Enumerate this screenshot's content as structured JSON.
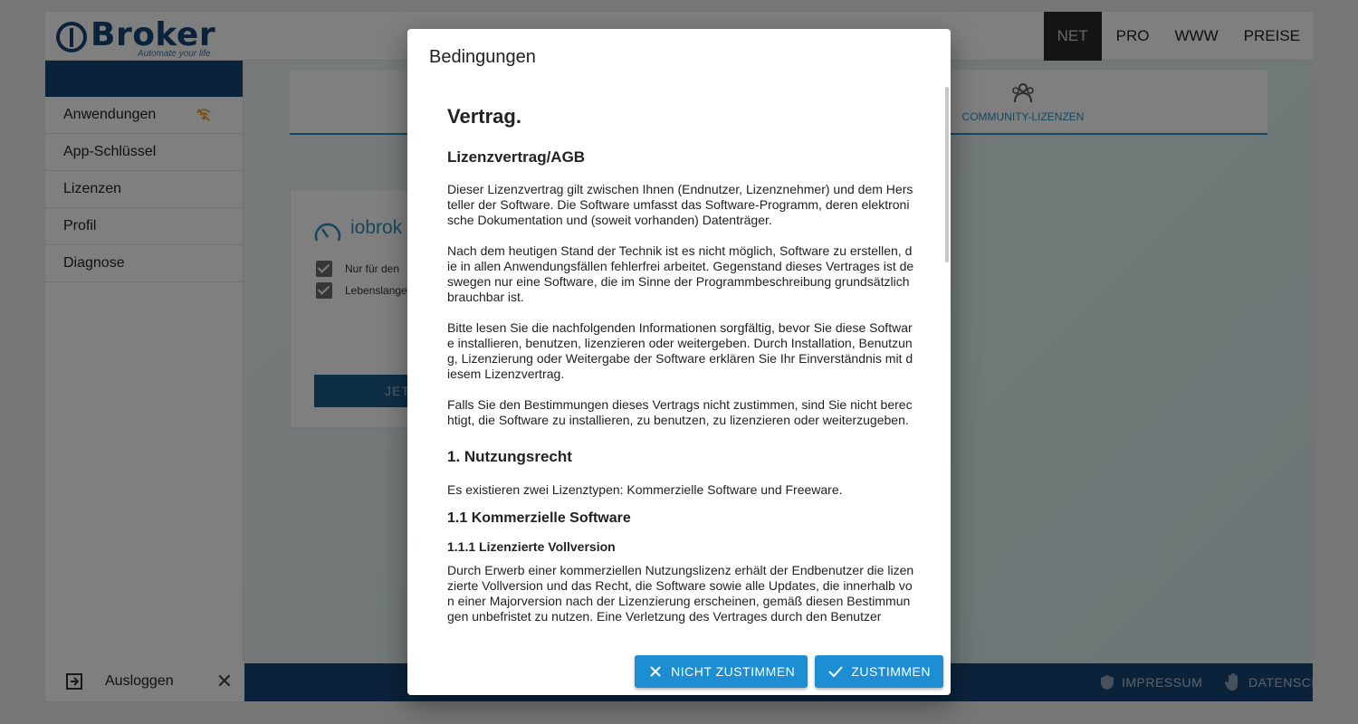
{
  "app": {
    "logo_text": "Broker",
    "logo_tagline": "Automate your life",
    "nav": [
      "NET",
      "PRO",
      "WWW",
      "PREISE"
    ],
    "sidebar": {
      "items": [
        {
          "label": "Anwendungen"
        },
        {
          "label": "App-Schlüssel"
        },
        {
          "label": "Lizenzen"
        },
        {
          "label": "Profil"
        },
        {
          "label": "Diagnose"
        }
      ],
      "logout_label": "Ausloggen"
    },
    "tabs": {
      "community_label": "COMMUNITY-LIZENZEN"
    },
    "card": {
      "title": "iobrok",
      "check1": "Nur für den",
      "check2": "Lebenslange",
      "buy_label": "JET"
    },
    "footer": {
      "impressum": "IMPRESSUM",
      "datenschutz": "DATENSCHUTZ"
    }
  },
  "dialog": {
    "title": "Bedingungen",
    "doc_title": "Vertrag.",
    "section_agb": "Lizenzvertrag/AGB",
    "p1": "Dieser Lizenzvertrag gilt zwischen Ihnen (Endnutzer, Lizenznehmer) und dem Hersteller der Software. Die Software umfasst das Software-Programm, deren elektronische Dokumentation und (soweit vorhanden) Datenträger.",
    "p2": "Nach dem heutigen Stand der Technik ist es nicht möglich, Software zu erstellen, die in allen Anwendungsfällen fehlerfrei arbeitet. Gegenstand dieses Vertrages ist deswegen nur eine Software, die im Sinne der Programmbeschreibung grundsätzlich brauchbar ist.",
    "p3": "Bitte lesen Sie die nachfolgenden Informationen sorgfältig, bevor Sie diese Software installieren, benutzen, lizenzieren oder weitergeben. Durch Installation, Benutzung, Lizenzierung oder Weitergabe der Software erklären Sie Ihr Einverständnis mit diesem Lizenzvertrag.",
    "p4": "Falls Sie den Bestimmungen dieses Vertrags nicht zustimmen, sind Sie nicht berechtigt, die Software zu installieren, zu benutzen, zu lizenzieren oder weiterzugeben.",
    "section1": "1. Nutzungsrecht",
    "p5": "Es existieren zwei Lizenztypen: Kommerzielle Software und Freeware.",
    "section11": "1.1 Kommerzielle Software",
    "section111": "1.1.1 Lizenzierte Vollversion",
    "p6": "Durch Erwerb einer kommerziellen Nutzungslizenz erhält der Endbenutzer die lizenzierte Vollversion und das Recht, die Software sowie alle Updates, die innerhalb von einer Majorversion nach der Lizenzierung erscheinen, gemäß diesen Bestimmungen unbefristet zu nutzen. Eine Verletzung des Vertrages durch den Benutzer",
    "btn_decline": "NICHT ZUSTIMMEN",
    "btn_accept": "ZUSTIMMEN"
  },
  "colors": {
    "primary": "#1d8ed1",
    "brand": "#164477",
    "accent": "#2a8fbf"
  }
}
